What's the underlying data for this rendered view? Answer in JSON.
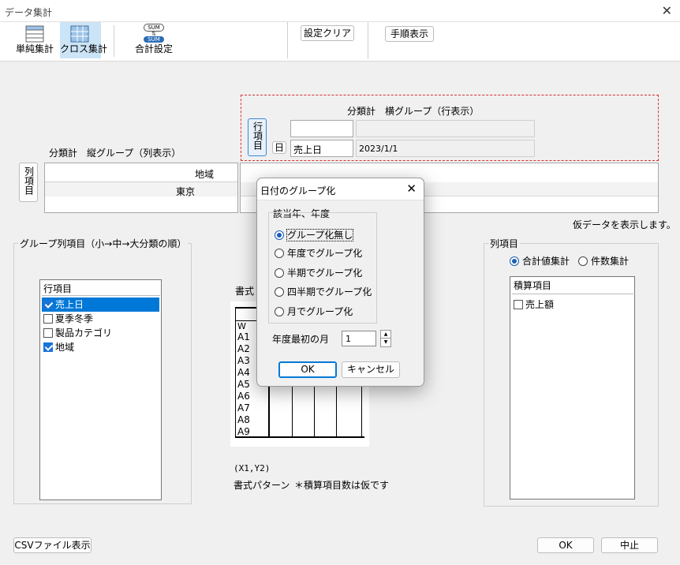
{
  "window": {
    "title": "データ集計",
    "close_glyph": "✕"
  },
  "toolbar": {
    "simple_agg": "単純集計",
    "cross_agg": "クロス集計",
    "sum_setting": "合計設定",
    "sum_icon_text": "SUM",
    "clear_settings": "設定クリア",
    "show_steps": "手順表示"
  },
  "row_group": {
    "caption": "分類計　横グループ（行表示）",
    "button": "行項目",
    "date_button": "日",
    "field": "売上日",
    "value": "2023/1/1"
  },
  "col_group": {
    "caption": "分類計　縦グループ（列表示）",
    "button": "列項目",
    "header": "地域",
    "value": "東京"
  },
  "temp_note": "仮データを表示します。",
  "group_cols": {
    "legend": "グループ列項目（小→中→大分類の順）",
    "list_header": "行項目",
    "items": [
      {
        "label": "売上日",
        "checked": true,
        "selected": true
      },
      {
        "label": "夏季冬季",
        "checked": false,
        "selected": false
      },
      {
        "label": "製品カテゴリ",
        "checked": false,
        "selected": false
      },
      {
        "label": "地域",
        "checked": true,
        "selected": false
      }
    ]
  },
  "format": {
    "label": "書式",
    "col_w": "W",
    "rows": [
      "A1",
      "A2",
      "A3",
      "A4",
      "A5",
      "A6",
      "A7",
      "A8",
      "A9"
    ],
    "coords": "(X1,Y2)",
    "pattern": "書式パターン",
    "note": "＊積算項目数は仮です"
  },
  "col_items": {
    "legend": "列項目",
    "sum_mode": "合計値集計",
    "count_mode": "件数集計",
    "list_header": "積算項目",
    "items": [
      {
        "label": "売上額",
        "checked": false
      }
    ]
  },
  "footer": {
    "csv": "CSVファイル表示",
    "ok": "OK",
    "cancel": "中止"
  },
  "dialog": {
    "title": "日付のグループ化",
    "close_glyph": "✕",
    "group_legend": "該当年、年度",
    "options": [
      {
        "label": "グループ化無し",
        "selected": true
      },
      {
        "label": "年度でグループ化",
        "selected": false
      },
      {
        "label": "半期でグループ化",
        "selected": false
      },
      {
        "label": "四半期でグループ化",
        "selected": false
      },
      {
        "label": "月でグループ化",
        "selected": false
      }
    ],
    "first_month_label": "年度最初の月",
    "first_month_value": "1",
    "ok": "OK",
    "cancel": "キャンセル"
  },
  "colors": {
    "accent": "#0078d7",
    "dashed_border": "#d83030",
    "toolbar_active": "#cce4f7"
  }
}
